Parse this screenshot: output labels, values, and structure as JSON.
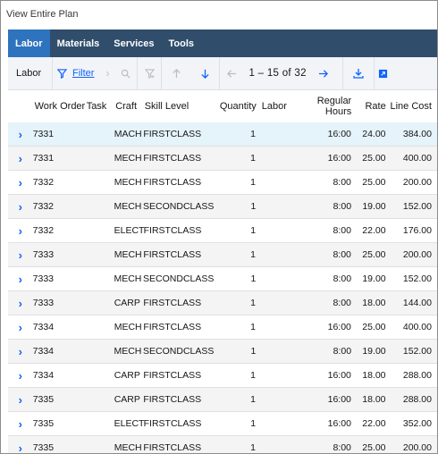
{
  "window": {
    "title": "View Entire Plan"
  },
  "tabs": [
    {
      "label": "Labor",
      "active": true
    },
    {
      "label": "Materials",
      "active": false
    },
    {
      "label": "Services",
      "active": false
    },
    {
      "label": "Tools",
      "active": false
    }
  ],
  "toolbar": {
    "label": "Labor",
    "filter_label": "Filter",
    "pager_text": "1 – 15 of 32"
  },
  "columns": [
    "Work Order",
    "Task",
    "Craft",
    "Skill Level",
    "Quantity",
    "Labor",
    "Regular Hours",
    "Rate",
    "Line Cost"
  ],
  "rows": [
    {
      "work_order": "7331",
      "task": "",
      "craft": "MACH",
      "skill": "FIRSTCLASS",
      "qty": "1",
      "labor": "",
      "hours": "16:00",
      "rate": "24.00",
      "line_cost": "384.00",
      "selected": true
    },
    {
      "work_order": "7331",
      "task": "",
      "craft": "MECH",
      "skill": "FIRSTCLASS",
      "qty": "1",
      "labor": "",
      "hours": "16:00",
      "rate": "25.00",
      "line_cost": "400.00"
    },
    {
      "work_order": "7332",
      "task": "",
      "craft": "MECH",
      "skill": "FIRSTCLASS",
      "qty": "1",
      "labor": "",
      "hours": "8:00",
      "rate": "25.00",
      "line_cost": "200.00"
    },
    {
      "work_order": "7332",
      "task": "",
      "craft": "MECH",
      "skill": "SECONDCLASS",
      "qty": "1",
      "labor": "",
      "hours": "8:00",
      "rate": "19.00",
      "line_cost": "152.00"
    },
    {
      "work_order": "7332",
      "task": "",
      "craft": "ELECT",
      "skill": "FIRSTCLASS",
      "qty": "1",
      "labor": "",
      "hours": "8:00",
      "rate": "22.00",
      "line_cost": "176.00"
    },
    {
      "work_order": "7333",
      "task": "",
      "craft": "MECH",
      "skill": "FIRSTCLASS",
      "qty": "1",
      "labor": "",
      "hours": "8:00",
      "rate": "25.00",
      "line_cost": "200.00"
    },
    {
      "work_order": "7333",
      "task": "",
      "craft": "MECH",
      "skill": "SECONDCLASS",
      "qty": "1",
      "labor": "",
      "hours": "8:00",
      "rate": "19.00",
      "line_cost": "152.00"
    },
    {
      "work_order": "7333",
      "task": "",
      "craft": "CARP",
      "skill": "FIRSTCLASS",
      "qty": "1",
      "labor": "",
      "hours": "8:00",
      "rate": "18.00",
      "line_cost": "144.00"
    },
    {
      "work_order": "7334",
      "task": "",
      "craft": "MECH",
      "skill": "FIRSTCLASS",
      "qty": "1",
      "labor": "",
      "hours": "16:00",
      "rate": "25.00",
      "line_cost": "400.00"
    },
    {
      "work_order": "7334",
      "task": "",
      "craft": "MECH",
      "skill": "SECONDCLASS",
      "qty": "1",
      "labor": "",
      "hours": "8:00",
      "rate": "19.00",
      "line_cost": "152.00"
    },
    {
      "work_order": "7334",
      "task": "",
      "craft": "CARP",
      "skill": "FIRSTCLASS",
      "qty": "1",
      "labor": "",
      "hours": "16:00",
      "rate": "18.00",
      "line_cost": "288.00"
    },
    {
      "work_order": "7335",
      "task": "",
      "craft": "CARP",
      "skill": "FIRSTCLASS",
      "qty": "1",
      "labor": "",
      "hours": "16:00",
      "rate": "18.00",
      "line_cost": "288.00"
    },
    {
      "work_order": "7335",
      "task": "",
      "craft": "ELECT",
      "skill": "FIRSTCLASS",
      "qty": "1",
      "labor": "",
      "hours": "16:00",
      "rate": "22.00",
      "line_cost": "352.00"
    },
    {
      "work_order": "7335",
      "task": "",
      "craft": "MECH",
      "skill": "FIRSTCLASS",
      "qty": "1",
      "labor": "",
      "hours": "8:00",
      "rate": "25.00",
      "line_cost": "200.00"
    }
  ],
  "icons": {
    "expand": "chevron-right-icon",
    "filter": "filter-icon",
    "search": "search-icon",
    "clear_filter": "clear-filter-icon",
    "sort_up": "arrow-up-icon",
    "sort_down": "arrow-down-icon",
    "prev": "arrow-left-icon",
    "next": "arrow-right-icon",
    "download": "download-icon",
    "export": "export-icon"
  },
  "colors": {
    "tab_bar": "#304e6b",
    "tab_active": "#2e73bd",
    "accent": "#0f62fe",
    "selected_row": "#e5f3fb"
  }
}
